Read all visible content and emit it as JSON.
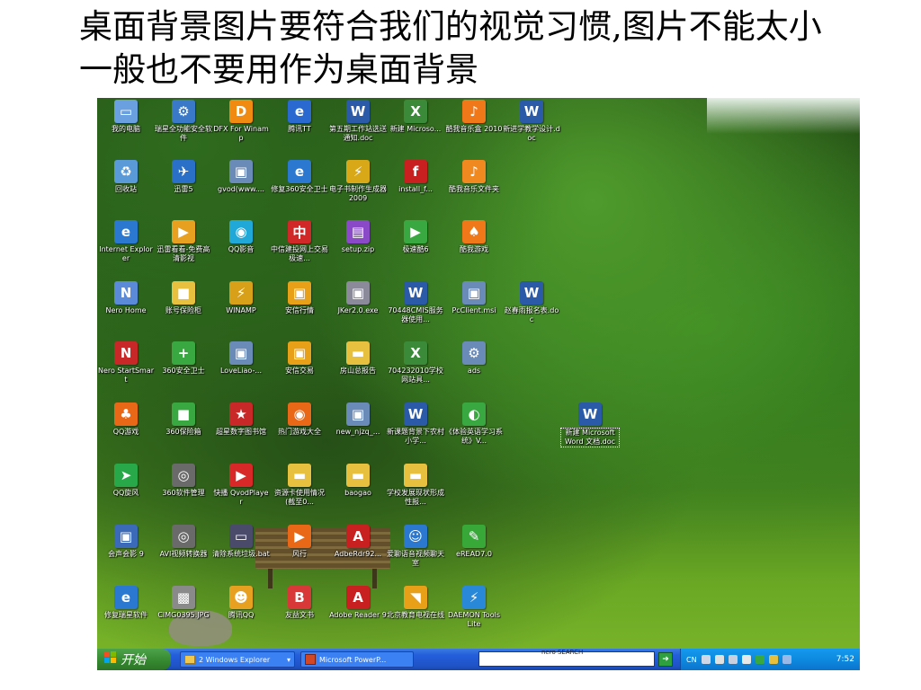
{
  "slide": {
    "title_line1": "桌面背景图片要符合我们的视觉习惯,图片不能太小",
    "title_line2": "一般也不要用作为桌面背景"
  },
  "desktop_icons": [
    {
      "label": "我的电脑",
      "icon": "computer-icon",
      "color": "#6aa0e0",
      "glyph": "▭"
    },
    {
      "label": "瑞星全功能安全软件",
      "icon": "shield-icon",
      "color": "#3a78c8",
      "glyph": "⚙"
    },
    {
      "label": "DFX For Winamp",
      "icon": "dfx-icon",
      "color": "#f08a10",
      "glyph": "D"
    },
    {
      "label": "腾讯TT",
      "icon": "browser-icon",
      "color": "#2a6ad0",
      "glyph": "e"
    },
    {
      "label": "第五期工作站选送通知.doc",
      "icon": "word-doc-icon",
      "color": "#2a5aa8",
      "glyph": "W"
    },
    {
      "label": "新建 Microso...",
      "icon": "excel-doc-icon",
      "color": "#3a8a3a",
      "glyph": "X"
    },
    {
      "label": "酷我音乐盒 2010",
      "icon": "music-icon",
      "color": "#f07818",
      "glyph": "♪"
    },
    {
      "label": "新进学教学设计.doc",
      "icon": "word-doc-icon",
      "color": "#2a5aa8",
      "glyph": "W"
    },
    {
      "label": "回收站",
      "icon": "recycle-bin-icon",
      "color": "#5a9ad8",
      "glyph": "♻"
    },
    {
      "label": "迅雷5",
      "icon": "thunder-icon",
      "color": "#2a70c8",
      "glyph": "✈"
    },
    {
      "label": "gvod(www....",
      "icon": "program-icon",
      "color": "#6a8ab8",
      "glyph": "▣"
    },
    {
      "label": "修复360安全卫士",
      "icon": "ie-icon",
      "color": "#2a78d0",
      "glyph": "e"
    },
    {
      "label": "电子书制作生成器2009",
      "icon": "ebook-icon",
      "color": "#d8a818",
      "glyph": "⚡"
    },
    {
      "label": "install_f...",
      "icon": "flash-icon",
      "color": "#c82020",
      "glyph": "f"
    },
    {
      "label": "酷我音乐文件夹",
      "icon": "music-folder-icon",
      "color": "#f08a20",
      "glyph": "♪"
    },
    {
      "label": "Internet Explorer",
      "icon": "ie-icon",
      "color": "#2a78d0",
      "glyph": "e"
    },
    {
      "label": "迅雷看看-免费高清影视",
      "icon": "video-icon",
      "color": "#e8a020",
      "glyph": "▶"
    },
    {
      "label": "QQ影音",
      "icon": "qq-player-icon",
      "color": "#20a8d8",
      "glyph": "◉"
    },
    {
      "label": "中信建投网上交易极速...",
      "icon": "stock-icon",
      "color": "#d02828",
      "glyph": "中"
    },
    {
      "label": "setup.zip",
      "icon": "zip-icon",
      "color": "#8a4ac8",
      "glyph": "▤"
    },
    {
      "label": "极速酷6",
      "icon": "ku6-icon",
      "color": "#3aa840",
      "glyph": "▶"
    },
    {
      "label": "酷我游戏",
      "icon": "game-icon",
      "color": "#f07818",
      "glyph": "♠"
    },
    {
      "label": "Nero Home",
      "icon": "nero-icon",
      "color": "#5a8ad8",
      "glyph": "N"
    },
    {
      "label": "账号保险柜",
      "icon": "safe-icon",
      "color": "#e8c040",
      "glyph": "■"
    },
    {
      "label": "WINAMP",
      "icon": "winamp-icon",
      "color": "#d8a018",
      "glyph": "⚡"
    },
    {
      "label": "安信行情",
      "icon": "program-icon",
      "color": "#e8a018",
      "glyph": "▣"
    },
    {
      "label": "JKer2.0.exe",
      "icon": "exe-icon",
      "color": "#8a8a9a",
      "glyph": "▣"
    },
    {
      "label": "70448CMIS服务器使用...",
      "icon": "word-doc-icon",
      "color": "#2a5aa8",
      "glyph": "W"
    },
    {
      "label": "PcClient.msi",
      "icon": "installer-icon",
      "color": "#6a8ab8",
      "glyph": "▣"
    },
    {
      "label": "赵春雨报名表.doc",
      "icon": "word-doc-icon",
      "color": "#2a5aa8",
      "glyph": "W"
    },
    {
      "label": "Nero StartSmart",
      "icon": "nero-icon",
      "color": "#c82828",
      "glyph": "N"
    },
    {
      "label": "360安全卫士",
      "icon": "shield-icon",
      "color": "#3aa840",
      "glyph": "+"
    },
    {
      "label": "LoveLiao-...",
      "icon": "program-icon",
      "color": "#6a8ab8",
      "glyph": "▣"
    },
    {
      "label": "安信交易",
      "icon": "program-icon",
      "color": "#e8a018",
      "glyph": "▣"
    },
    {
      "label": "房山总报告",
      "icon": "folder-icon",
      "color": "#e8c040",
      "glyph": "▬"
    },
    {
      "label": "704232010学校网站具...",
      "icon": "excel-doc-icon",
      "color": "#3a8a3a",
      "glyph": "X"
    },
    {
      "label": "ads",
      "icon": "network-icon",
      "color": "#6a8ab8",
      "glyph": "⚙"
    },
    {
      "label": "QQ游戏",
      "icon": "qq-game-icon",
      "color": "#e86818",
      "glyph": "♣"
    },
    {
      "label": "360保险箱",
      "icon": "safe-icon",
      "color": "#3aa840",
      "glyph": "■"
    },
    {
      "label": "超星数字图书馆",
      "icon": "superstar-icon",
      "color": "#c82828",
      "glyph": "★"
    },
    {
      "label": "热门游戏大全",
      "icon": "game-icon",
      "color": "#e86818",
      "glyph": "◉"
    },
    {
      "label": "new_njzq_...",
      "icon": "program-icon",
      "color": "#6a8ab8",
      "glyph": "▣"
    },
    {
      "label": "新课题背景下农村小学...",
      "icon": "word-doc-icon",
      "color": "#2a5aa8",
      "glyph": "W"
    },
    {
      "label": "《体验英语学习系统》V...",
      "icon": "english-icon",
      "color": "#3aa840",
      "glyph": "◐"
    },
    {
      "label": "新建 Microsoft Word 文档.doc",
      "icon": "word-doc-icon",
      "color": "#2a5aa8",
      "glyph": "W"
    },
    {
      "label": "QQ旋风",
      "icon": "qq-whirlwind-icon",
      "color": "#28a848",
      "glyph": "➤"
    },
    {
      "label": "360软件管理",
      "icon": "software-icon",
      "color": "#6a6a6a",
      "glyph": "◎"
    },
    {
      "label": "快播 QvodPlayer",
      "icon": "qvod-icon",
      "color": "#d82828",
      "glyph": "▶"
    },
    {
      "label": "资源卡使用情况(截至0...",
      "icon": "folder-icon",
      "color": "#e8c040",
      "glyph": "▬"
    },
    {
      "label": "baogao",
      "icon": "folder-icon",
      "color": "#e8c040",
      "glyph": "▬"
    },
    {
      "label": "学校发展现状形成性报...",
      "icon": "folder-icon",
      "color": "#e8c040",
      "glyph": "▬"
    },
    {
      "label": "会声会影 9",
      "icon": "video-edit-icon",
      "color": "#3a6ab8",
      "glyph": "▣"
    },
    {
      "label": "AVI视频转换器",
      "icon": "converter-icon",
      "color": "#6a6a6a",
      "glyph": "◎"
    },
    {
      "label": "清除系统垃圾.bat",
      "icon": "bat-icon",
      "color": "#4a4a6a",
      "glyph": "▭"
    },
    {
      "label": "风行",
      "icon": "funshion-icon",
      "color": "#e86818",
      "glyph": "▶"
    },
    {
      "label": "AdbeRdr92...",
      "icon": "pdf-icon",
      "color": "#c82020",
      "glyph": "A"
    },
    {
      "label": "爱聊语音视频聊天室",
      "icon": "chat-icon",
      "color": "#2a78d0",
      "glyph": "☺"
    },
    {
      "label": "eREAD7.0",
      "icon": "eread-icon",
      "color": "#38a838",
      "glyph": "✎"
    },
    {
      "label": "修复瑞星软件",
      "icon": "ie-icon",
      "color": "#2a78d0",
      "glyph": "e"
    },
    {
      "label": "CIMG0395.JPG",
      "icon": "image-icon",
      "color": "#8a8a8a",
      "glyph": "▩"
    },
    {
      "label": "腾讯QQ",
      "icon": "qq-icon",
      "color": "#e8a020",
      "glyph": "☻"
    },
    {
      "label": "友益文书",
      "icon": "document-icon",
      "color": "#d83838",
      "glyph": "B"
    },
    {
      "label": "Adobe Reader 9",
      "icon": "pdf-icon",
      "color": "#c82020",
      "glyph": "A"
    },
    {
      "label": "北京教育电视在线",
      "icon": "tv-icon",
      "color": "#e8a018",
      "glyph": "◥"
    },
    {
      "label": "DAEMON Tools Lite",
      "icon": "daemon-icon",
      "color": "#2a88d8",
      "glyph": "⚡"
    }
  ],
  "taskbar": {
    "start_label": "开始",
    "buttons": [
      {
        "label": "2 Windows Explorer",
        "icon": "folder-icon"
      },
      {
        "label": "Microsoft PowerP...",
        "icon": "powerpoint-icon"
      }
    ],
    "search_brand": "nero SEARCH",
    "tray_lang": "CN",
    "clock": "7:52"
  },
  "colors": {
    "taskbar": "#245edb",
    "start": "#35872f",
    "tray": "#0d8ae0"
  }
}
